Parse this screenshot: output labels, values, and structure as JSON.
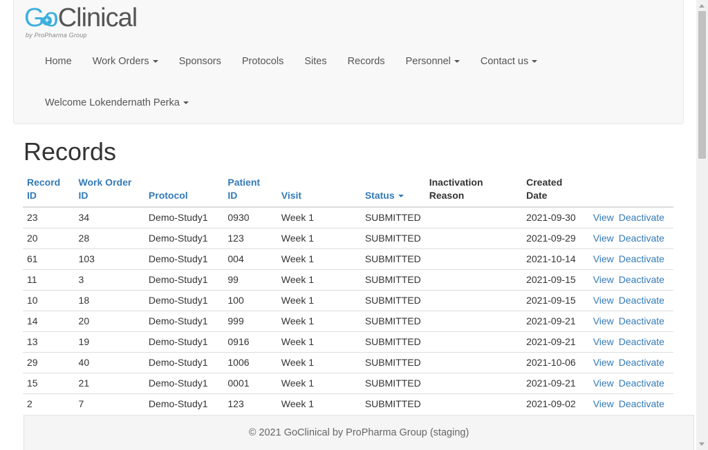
{
  "brand": {
    "logo_go": "Go",
    "logo_clinical": "Clinical",
    "logo_sub": "by ProPharma Group"
  },
  "nav": {
    "items": [
      {
        "label": "Home",
        "dropdown": false
      },
      {
        "label": "Work Orders",
        "dropdown": true
      },
      {
        "label": "Sponsors",
        "dropdown": false
      },
      {
        "label": "Protocols",
        "dropdown": false
      },
      {
        "label": "Sites",
        "dropdown": false
      },
      {
        "label": "Records",
        "dropdown": false
      },
      {
        "label": "Personnel",
        "dropdown": true
      },
      {
        "label": "Contact us",
        "dropdown": true
      }
    ],
    "user": "Welcome Lokendernath Perka"
  },
  "page": {
    "title": "Records"
  },
  "table": {
    "headers": {
      "record_id": [
        "Record",
        "ID"
      ],
      "work_order_id": [
        "Work Order",
        "ID"
      ],
      "protocol": "Protocol",
      "patient_id": [
        "Patient",
        "ID"
      ],
      "visit": "Visit",
      "status": "Status",
      "inactivation_reason": [
        "Inactivation",
        "Reason"
      ],
      "created_date": [
        "Created",
        "Date"
      ]
    },
    "action_view": "View",
    "action_deactivate": "Deactivate",
    "rows": [
      {
        "record_id": "23",
        "work_order_id": "34",
        "protocol": "Demo-Study1",
        "patient_id": "0930",
        "visit": "Week 1",
        "status": "SUBMITTED",
        "reason": "",
        "created": "2021-09-30"
      },
      {
        "record_id": "20",
        "work_order_id": "28",
        "protocol": "Demo-Study1",
        "patient_id": "123",
        "visit": "Week 1",
        "status": "SUBMITTED",
        "reason": "",
        "created": "2021-09-29"
      },
      {
        "record_id": "61",
        "work_order_id": "103",
        "protocol": "Demo-Study1",
        "patient_id": "004",
        "visit": "Week 1",
        "status": "SUBMITTED",
        "reason": "",
        "created": "2021-10-14"
      },
      {
        "record_id": "11",
        "work_order_id": "3",
        "protocol": "Demo-Study1",
        "patient_id": "99",
        "visit": "Week 1",
        "status": "SUBMITTED",
        "reason": "",
        "created": "2021-09-15"
      },
      {
        "record_id": "10",
        "work_order_id": "18",
        "protocol": "Demo-Study1",
        "patient_id": "100",
        "visit": "Week 1",
        "status": "SUBMITTED",
        "reason": "",
        "created": "2021-09-15"
      },
      {
        "record_id": "14",
        "work_order_id": "20",
        "protocol": "Demo-Study1",
        "patient_id": "999",
        "visit": "Week 1",
        "status": "SUBMITTED",
        "reason": "",
        "created": "2021-09-21"
      },
      {
        "record_id": "13",
        "work_order_id": "19",
        "protocol": "Demo-Study1",
        "patient_id": "0916",
        "visit": "Week 1",
        "status": "SUBMITTED",
        "reason": "",
        "created": "2021-09-21"
      },
      {
        "record_id": "29",
        "work_order_id": "40",
        "protocol": "Demo-Study1",
        "patient_id": "1006",
        "visit": "Week 1",
        "status": "SUBMITTED",
        "reason": "",
        "created": "2021-10-06"
      },
      {
        "record_id": "15",
        "work_order_id": "21",
        "protocol": "Demo-Study1",
        "patient_id": "0001",
        "visit": "Week 1",
        "status": "SUBMITTED",
        "reason": "",
        "created": "2021-09-21"
      },
      {
        "record_id": "2",
        "work_order_id": "7",
        "protocol": "Demo-Study1",
        "patient_id": "123",
        "visit": "Week 1",
        "status": "SUBMITTED",
        "reason": "",
        "created": "2021-09-02"
      }
    ]
  },
  "footer": {
    "text": "© 2021 GoClinical by ProPharma Group (staging)"
  },
  "colors": {
    "link": "#337ab7",
    "brand_blue": "#3bb0de",
    "navbar_bg": "#f8f8f8"
  }
}
